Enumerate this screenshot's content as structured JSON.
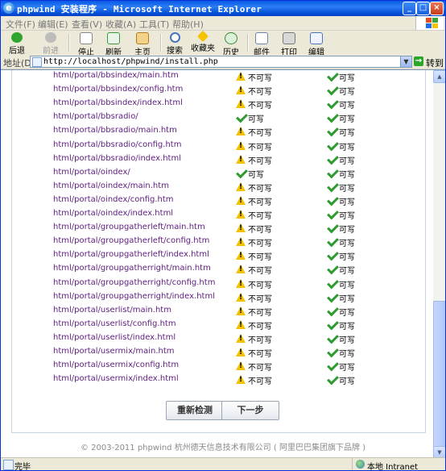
{
  "window": {
    "title": "phpwind 安装程序 - Microsoft Internet Explorer",
    "controls": {
      "minimize": "_",
      "maximize": "□",
      "close": "×"
    }
  },
  "menu": {
    "items": [
      "文件(F)",
      "编辑(E)",
      "查看(V)",
      "收藏(A)",
      "工具(T)",
      "帮助(H)"
    ]
  },
  "toolbar": {
    "back": "后退",
    "forward": "前进",
    "stop": "停止",
    "refresh": "刷新",
    "home": "主页",
    "search": "搜索",
    "favorites": "收藏夹",
    "history": "历史",
    "mail": "邮件",
    "print": "打印",
    "edit": "编辑"
  },
  "address": {
    "label": "地址(D)",
    "url": "http://localhost/phpwind/install.php",
    "go": "转到"
  },
  "rows": [
    {
      "path": "html/portal/bbsindex/main.htm",
      "read": "warn",
      "read_label": "不可写",
      "write": "ok",
      "write_label": "可写"
    },
    {
      "path": "html/portal/bbsindex/config.htm",
      "read": "warn",
      "read_label": "不可写",
      "write": "ok",
      "write_label": "可写"
    },
    {
      "path": "html/portal/bbsindex/index.html",
      "read": "warn",
      "read_label": "不可写",
      "write": "ok",
      "write_label": "可写"
    },
    {
      "path": "html/portal/bbsradio/",
      "read": "ok",
      "read_label": "可写",
      "write": "ok",
      "write_label": "可写"
    },
    {
      "path": "html/portal/bbsradio/main.htm",
      "read": "warn",
      "read_label": "不可写",
      "write": "ok",
      "write_label": "可写"
    },
    {
      "path": "html/portal/bbsradio/config.htm",
      "read": "warn",
      "read_label": "不可写",
      "write": "ok",
      "write_label": "可写"
    },
    {
      "path": "html/portal/bbsradio/index.html",
      "read": "warn",
      "read_label": "不可写",
      "write": "ok",
      "write_label": "可写"
    },
    {
      "path": "html/portal/oindex/",
      "read": "ok",
      "read_label": "可写",
      "write": "ok",
      "write_label": "可写"
    },
    {
      "path": "html/portal/oindex/main.htm",
      "read": "warn",
      "read_label": "不可写",
      "write": "ok",
      "write_label": "可写"
    },
    {
      "path": "html/portal/oindex/config.htm",
      "read": "warn",
      "read_label": "不可写",
      "write": "ok",
      "write_label": "可写"
    },
    {
      "path": "html/portal/oindex/index.html",
      "read": "warn",
      "read_label": "不可写",
      "write": "ok",
      "write_label": "可写"
    },
    {
      "path": "html/portal/groupgatherleft/main.htm",
      "read": "warn",
      "read_label": "不可写",
      "write": "ok",
      "write_label": "可写"
    },
    {
      "path": "html/portal/groupgatherleft/config.htm",
      "read": "warn",
      "read_label": "不可写",
      "write": "ok",
      "write_label": "可写"
    },
    {
      "path": "html/portal/groupgatherleft/index.html",
      "read": "warn",
      "read_label": "不可写",
      "write": "ok",
      "write_label": "可写"
    },
    {
      "path": "html/portal/groupgatherright/main.htm",
      "read": "warn",
      "read_label": "不可写",
      "write": "ok",
      "write_label": "可写"
    },
    {
      "path": "html/portal/groupgatherright/config.htm",
      "read": "warn",
      "read_label": "不可写",
      "write": "ok",
      "write_label": "可写"
    },
    {
      "path": "html/portal/groupgatherright/index.html",
      "read": "warn",
      "read_label": "不可写",
      "write": "ok",
      "write_label": "可写"
    },
    {
      "path": "html/portal/userlist/main.htm",
      "read": "warn",
      "read_label": "不可写",
      "write": "ok",
      "write_label": "可写"
    },
    {
      "path": "html/portal/userlist/config.htm",
      "read": "warn",
      "read_label": "不可写",
      "write": "ok",
      "write_label": "可写"
    },
    {
      "path": "html/portal/userlist/index.html",
      "read": "warn",
      "read_label": "不可写",
      "write": "ok",
      "write_label": "可写"
    },
    {
      "path": "html/portal/usermix/main.htm",
      "read": "warn",
      "read_label": "不可写",
      "write": "ok",
      "write_label": "可写"
    },
    {
      "path": "html/portal/usermix/config.htm",
      "read": "warn",
      "read_label": "不可写",
      "write": "ok",
      "write_label": "可写"
    },
    {
      "path": "html/portal/usermix/index.html",
      "read": "warn",
      "read_label": "不可写",
      "write": "ok",
      "write_label": "可写"
    }
  ],
  "buttons": {
    "recheck": "重新检测",
    "next": "下一步"
  },
  "footer": "© 2003-2011 phpwind 杭州德天信息技术有限公司 ( 阿里巴巴集团旗下品牌 )",
  "status": {
    "text": "完毕",
    "zone": "本地 Intranet"
  },
  "colors": {
    "path_link": "#602080",
    "warn": "#f2c200",
    "ok": "#2f9a2f",
    "titlebar": "#0a5ae6"
  }
}
